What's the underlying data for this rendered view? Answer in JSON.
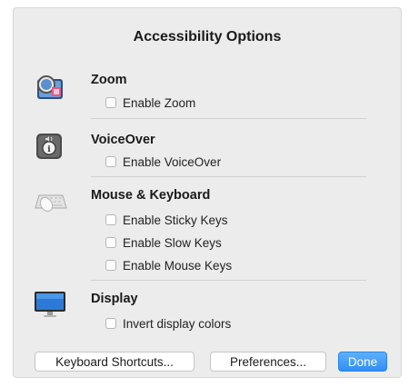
{
  "dialog": {
    "title": "Accessibility Options",
    "sections": [
      {
        "title": "Zoom",
        "icon": "zoom-icon",
        "options": [
          {
            "label": "Enable Zoom",
            "checked": false
          }
        ]
      },
      {
        "title": "VoiceOver",
        "icon": "voiceover-icon",
        "options": [
          {
            "label": "Enable VoiceOver",
            "checked": false
          }
        ]
      },
      {
        "title": "Mouse & Keyboard",
        "icon": "mouse-keyboard-icon",
        "options": [
          {
            "label": "Enable Sticky Keys",
            "checked": false
          },
          {
            "label": "Enable Slow Keys",
            "checked": false
          },
          {
            "label": "Enable Mouse Keys",
            "checked": false
          }
        ]
      },
      {
        "title": "Display",
        "icon": "display-icon",
        "options": [
          {
            "label": "Invert display colors",
            "checked": false
          }
        ]
      }
    ],
    "buttons": {
      "shortcuts": "Keyboard Shortcuts...",
      "preferences": "Preferences...",
      "done": "Done"
    }
  },
  "colors": {
    "accent": "#3a97f7",
    "background": "#ececec"
  }
}
